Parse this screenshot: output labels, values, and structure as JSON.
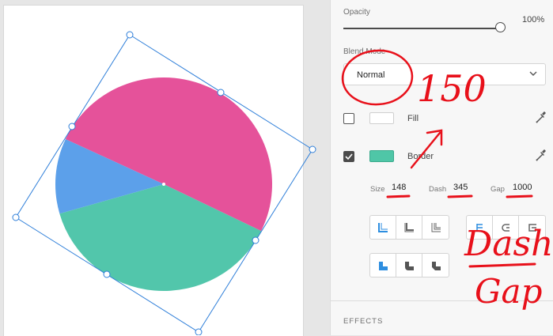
{
  "panel": {
    "opacity": {
      "label": "Opacity",
      "value": "100%",
      "level": 1.0
    },
    "blend": {
      "label": "Blend Mode",
      "value": "Normal"
    },
    "fill": {
      "label": "Fill",
      "checked": false,
      "color": "#ffffff"
    },
    "border": {
      "label": "Border",
      "checked": true,
      "color": "#4fc6a7"
    },
    "stroke": {
      "size_label": "Size",
      "size_value": "148",
      "dash_label": "Dash",
      "dash_value": "345",
      "gap_label": "Gap",
      "gap_value": "1000"
    },
    "effects_label": "EFFECTS"
  },
  "pie": {
    "slices": [
      {
        "name": "pink",
        "color": "#e5529a",
        "fraction": 0.55
      },
      {
        "name": "green",
        "color": "#52c6ab",
        "fraction": 0.34
      },
      {
        "name": "blue",
        "color": "#5ca0ea",
        "fraction": 0.11
      }
    ],
    "selection_color": "#2f7fd9"
  },
  "annotations": {
    "number": "150",
    "dash_word": "Dash",
    "gap_word": "Gap",
    "ink_color": "#e8101a"
  },
  "icons": {
    "chevron": "chevron-down-icon",
    "eyedropper": "eyedropper-icon",
    "check": "checkmark-icon"
  }
}
